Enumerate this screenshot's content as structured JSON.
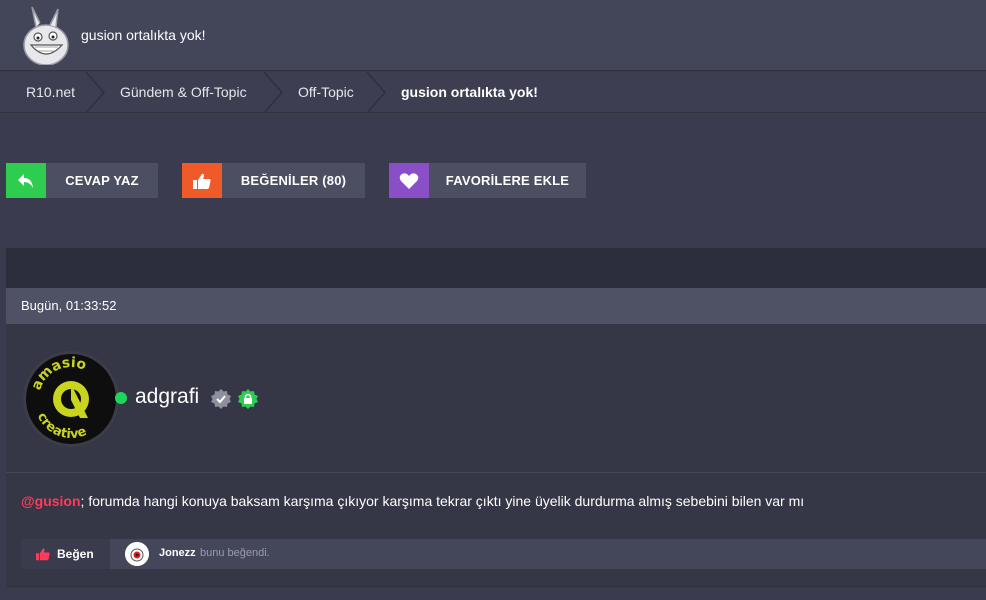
{
  "header": {
    "title": "gusion ortalıkta yok!",
    "logo_icon": "grinning-rabbit-logo"
  },
  "breadcrumb": {
    "items": [
      {
        "label": "R10.net"
      },
      {
        "label": "Gündem & Off-Topic"
      },
      {
        "label": "Off-Topic"
      },
      {
        "label": "gusion ortalıkta yok!"
      }
    ]
  },
  "actions": {
    "reply": {
      "label": "CEVAP YAZ",
      "color": "#2ecc4f",
      "icon": "reply-arrow-icon"
    },
    "likes": {
      "label": "BEĞENİLER (80)",
      "color": "#f05a28",
      "icon": "thumbs-up-icon"
    },
    "favorite": {
      "label": "FAVORİLERE EKLE",
      "color": "#8a4fc7",
      "icon": "heart-icon"
    }
  },
  "post": {
    "date": "Bugün, 01:33:52",
    "author": {
      "username": "adgrafi",
      "status": "online",
      "avatar_text": "amasio creative",
      "badges": [
        "verified-badge-icon",
        "lock-badge-icon"
      ]
    },
    "mention": "@gusion",
    "text": "; forumda hangi konuya baksam karşıma çıkıyor karşıma tekrar çıktı yine üyelik durdurma almış sebebini bilen var mı",
    "like_button": "Beğen",
    "liked_by": {
      "name": "Jonezz",
      "suffix": "bunu beğendi."
    }
  },
  "colors": {
    "accent_red": "#ff3b5c",
    "online_green": "#1fd65c"
  }
}
